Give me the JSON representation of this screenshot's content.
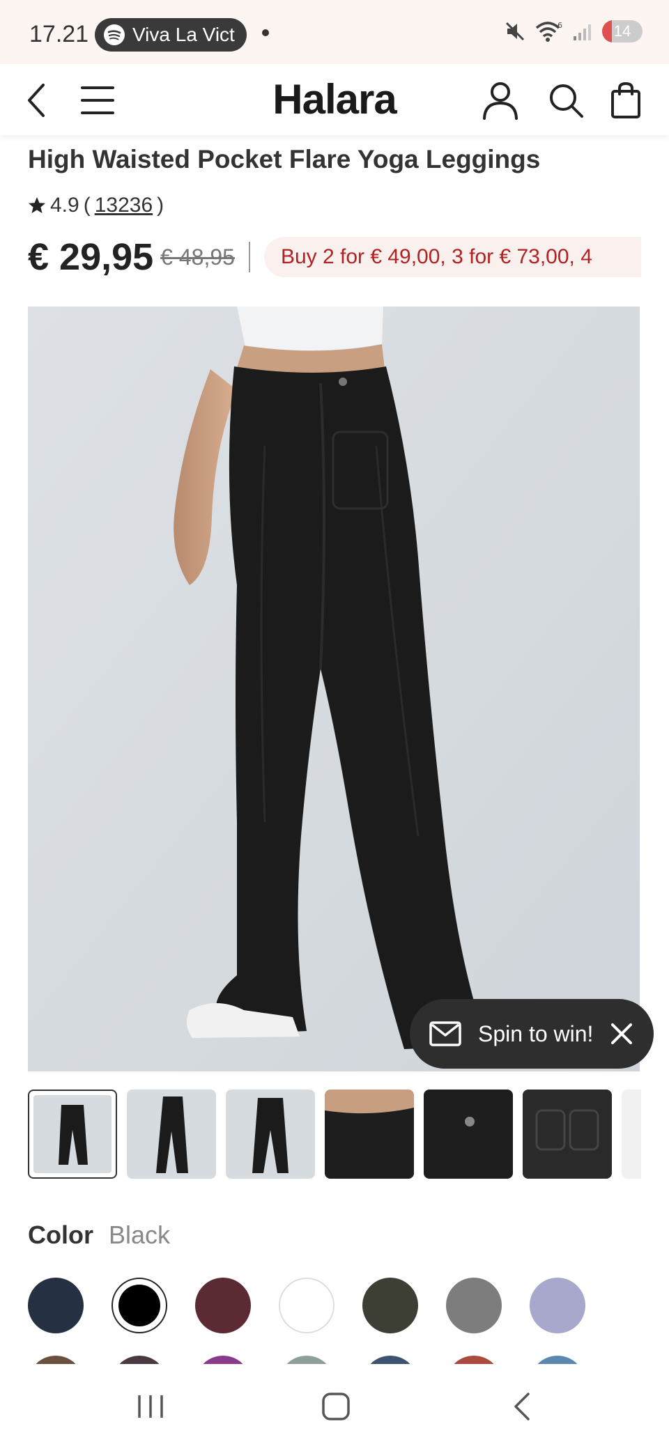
{
  "status_bar": {
    "time": "17.21",
    "now_playing": "Viva La Vict",
    "battery": "14"
  },
  "header": {
    "brand": "Halara",
    "icons": [
      "back-icon",
      "menu-icon",
      "account-icon",
      "search-icon",
      "bag-icon"
    ]
  },
  "product": {
    "title": "High Waisted Pocket Flare Yoga Leggings",
    "rating": "4.9",
    "review_count": "13236",
    "price": "€ 29,95",
    "original_price": "€ 48,95",
    "promo": "Buy 2 for € 49,00, 3 for € 73,00, 4"
  },
  "popup": {
    "label": "Spin to win!"
  },
  "color": {
    "label": "Color",
    "selected": "Black",
    "swatches": [
      "#263043",
      "#000000",
      "#5b2a33",
      "#ffffff",
      "#3d3f34",
      "#7d7d7d",
      "#a7a8cb"
    ],
    "swatches_row2": [
      "#6b5040",
      "#4a3a44",
      "#8a3a8a",
      "#8e9e98",
      "#3d5470",
      "#a94a40",
      "#5c88b0"
    ]
  },
  "colors": {
    "promo_text": "#b02222",
    "promo_bg": "#faf0ee",
    "image_bg": "#d6dbe0"
  }
}
